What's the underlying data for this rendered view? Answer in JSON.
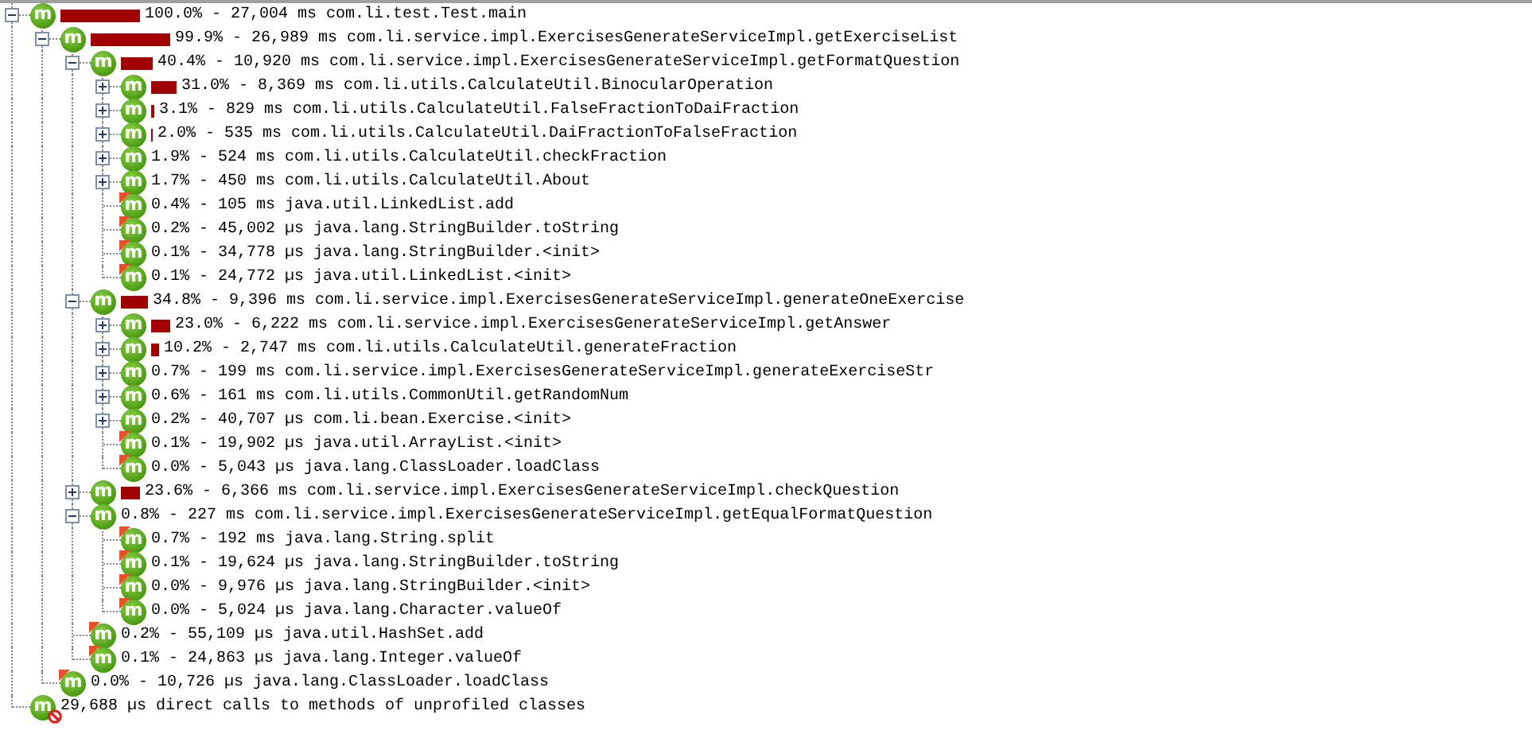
{
  "nodes": [
    {
      "percent": "100.0%",
      "text": "- 27,004 ms com.li.test.Test.main",
      "badge": "m",
      "kind": "method",
      "expanded": true,
      "children": [
        {
          "percent": "99.9%",
          "text": "- 26,989 ms com.li.service.impl.ExercisesGenerateServiceImpl.getExerciseList",
          "badge": "m",
          "kind": "method",
          "expanded": true,
          "children": [
            {
              "percent": "40.4%",
              "text": "- 10,920 ms com.li.service.impl.ExercisesGenerateServiceImpl.getFormatQuestion",
              "badge": "m",
              "kind": "method",
              "expanded": true,
              "children": [
                {
                  "percent": "31.0%",
                  "text": "- 8,369 ms com.li.utils.CalculateUtil.BinocularOperation",
                  "badge": "m",
                  "kind": "method",
                  "expanded": false
                },
                {
                  "percent": "3.1%",
                  "text": "- 829 ms com.li.utils.CalculateUtil.FalseFractionToDaiFraction",
                  "badge": "m",
                  "kind": "method",
                  "expanded": false
                },
                {
                  "percent": "2.0%",
                  "text": "- 535 ms com.li.utils.CalculateUtil.DaiFractionToFalseFraction",
                  "badge": "m",
                  "kind": "method",
                  "expanded": false
                },
                {
                  "percent": "1.9%",
                  "text": "- 524 ms com.li.utils.CalculateUtil.checkFraction",
                  "badge": "m",
                  "kind": "method",
                  "expanded": false
                },
                {
                  "percent": "1.7%",
                  "text": "- 450 ms com.li.utils.CalculateUtil.About",
                  "badge": "m",
                  "kind": "method",
                  "expanded": false
                },
                {
                  "percent": "0.4%",
                  "text": "- 105 ms java.util.LinkedList.add",
                  "badge": "m",
                  "kind": "leaf"
                },
                {
                  "percent": "0.2%",
                  "text": "- 45,002 µs java.lang.StringBuilder.toString",
                  "badge": "m",
                  "kind": "leaf"
                },
                {
                  "percent": "0.1%",
                  "text": "- 34,778 µs java.lang.StringBuilder.<init>",
                  "badge": "m",
                  "kind": "leaf"
                },
                {
                  "percent": "0.1%",
                  "text": "- 24,772 µs java.util.LinkedList.<init>",
                  "badge": "m",
                  "kind": "leaf"
                }
              ]
            },
            {
              "percent": "34.8%",
              "text": "- 9,396 ms com.li.service.impl.ExercisesGenerateServiceImpl.generateOneExercise",
              "badge": "m",
              "kind": "method",
              "expanded": true,
              "children": [
                {
                  "percent": "23.0%",
                  "text": "- 6,222 ms com.li.service.impl.ExercisesGenerateServiceImpl.getAnswer",
                  "badge": "m",
                  "kind": "method",
                  "expanded": false
                },
                {
                  "percent": "10.2%",
                  "text": "- 2,747 ms com.li.utils.CalculateUtil.generateFraction",
                  "badge": "m",
                  "kind": "method",
                  "expanded": false
                },
                {
                  "percent": "0.7%",
                  "text": "- 199 ms com.li.service.impl.ExercisesGenerateServiceImpl.generateExerciseStr",
                  "badge": "m",
                  "kind": "method",
                  "expanded": false
                },
                {
                  "percent": "0.6%",
                  "text": "- 161 ms com.li.utils.CommonUtil.getRandomNum",
                  "badge": "m",
                  "kind": "method",
                  "expanded": false
                },
                {
                  "percent": "0.2%",
                  "text": "- 40,707 µs com.li.bean.Exercise.<init>",
                  "badge": "m",
                  "kind": "method",
                  "expanded": false
                },
                {
                  "percent": "0.1%",
                  "text": "- 19,902 µs java.util.ArrayList.<init>",
                  "badge": "m",
                  "kind": "leaf"
                },
                {
                  "percent": "0.0%",
                  "text": "- 5,043 µs java.lang.ClassLoader.loadClass",
                  "badge": "m",
                  "kind": "leaf"
                }
              ]
            },
            {
              "percent": "23.6%",
              "text": "- 6,366 ms com.li.service.impl.ExercisesGenerateServiceImpl.checkQuestion",
              "badge": "m",
              "kind": "method",
              "expanded": false
            },
            {
              "percent": "0.8%",
              "text": "- 227 ms com.li.service.impl.ExercisesGenerateServiceImpl.getEqualFormatQuestion",
              "badge": "m",
              "kind": "method",
              "expanded": true,
              "children": [
                {
                  "percent": "0.7%",
                  "text": "- 192 ms java.lang.String.split",
                  "badge": "m",
                  "kind": "leaf"
                },
                {
                  "percent": "0.1%",
                  "text": "- 19,624 µs java.lang.StringBuilder.toString",
                  "badge": "m",
                  "kind": "leaf"
                },
                {
                  "percent": "0.0%",
                  "text": "- 9,976 µs java.lang.StringBuilder.<init>",
                  "badge": "m",
                  "kind": "leaf"
                },
                {
                  "percent": "0.0%",
                  "text": "- 5,024 µs java.lang.Character.valueOf",
                  "badge": "m",
                  "kind": "leaf"
                }
              ]
            },
            {
              "percent": "0.2%",
              "text": "- 55,109 µs java.util.HashSet.add",
              "badge": "m",
              "kind": "leaf"
            },
            {
              "percent": "0.1%",
              "text": "- 24,863 µs java.lang.Integer.valueOf",
              "badge": "m",
              "kind": "leaf"
            }
          ]
        },
        {
          "percent": "0.0%",
          "text": "- 10,726 µs java.lang.ClassLoader.loadClass",
          "badge": "m",
          "kind": "leaf"
        }
      ]
    },
    {
      "text": "29,688 µs direct calls to methods of unprofiled classes",
      "badge": "m",
      "kind": "unprofiled"
    }
  ]
}
